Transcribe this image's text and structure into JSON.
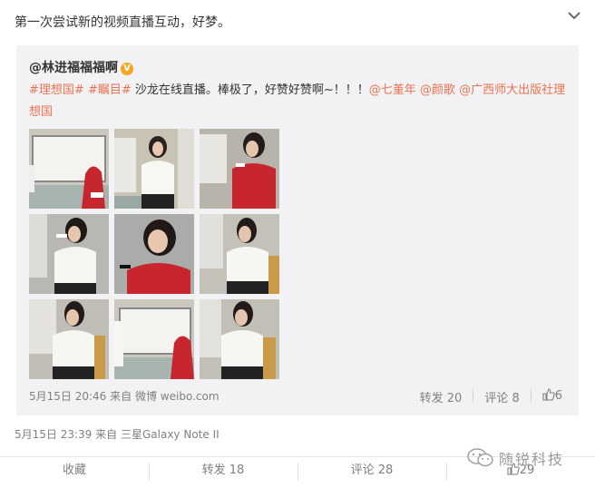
{
  "post": {
    "text": "第一次尝试新的视频直播互动，好梦。"
  },
  "repost": {
    "author": "@林进福福福啊",
    "verified_badge": "V",
    "text_parts": [
      {
        "text": "#理想国#",
        "link": true
      },
      {
        "text": " ",
        "link": false
      },
      {
        "text": "#瞩目#",
        "link": true
      },
      {
        "text": " 沙龙在线直播。棒极了，好赞好赞啊~！！！",
        "link": false
      },
      {
        "text": "@七堇年",
        "link": true
      },
      {
        "text": " ",
        "link": false
      },
      {
        "text": "@颜歌",
        "link": true
      },
      {
        "text": " ",
        "link": false
      },
      {
        "text": "@广西师大出版社理想国",
        "link": true
      }
    ],
    "photo_count": 9,
    "time": "5月15日 20:46",
    "source_prefix": "来自",
    "source": "微博 weibo.com",
    "forward_label": "转发 20",
    "comment_label": "评论 8",
    "like_count": "6"
  },
  "post_time": "5月15日 23:39",
  "post_source_prefix": "来自",
  "post_source": "三星Galaxy Note II",
  "bottom_bar": {
    "favorite": "收藏",
    "forward": "转发 18",
    "comment": "评论 28",
    "like": "29"
  },
  "watermark": {
    "text": "随锐科技"
  },
  "colors": {
    "link": "#eb7350",
    "red_dress": "#c8262e",
    "background_gray": "#f2f2f5"
  }
}
